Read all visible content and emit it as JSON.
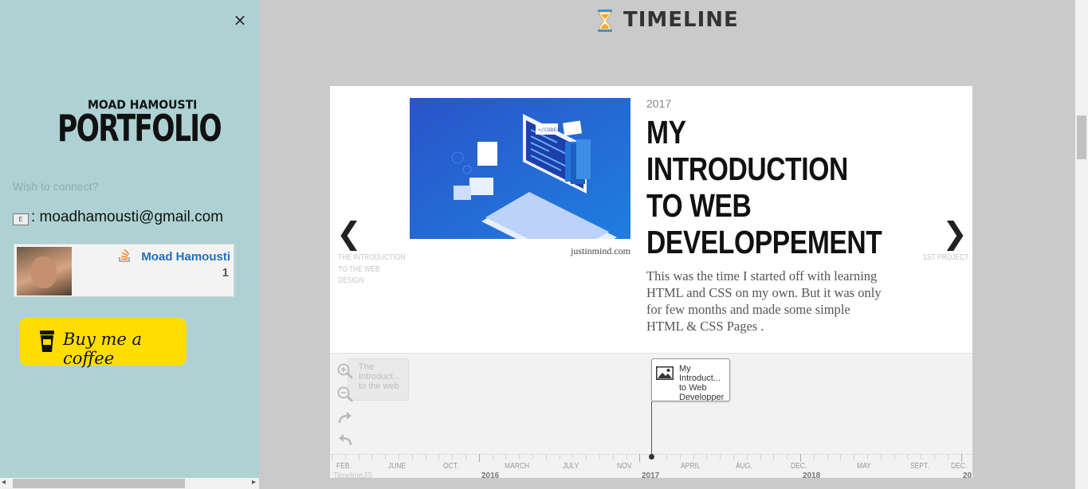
{
  "sidebar": {
    "close_label": "×",
    "logo": {
      "small_text": "MOAD HAMOUSTI",
      "big_text": "PORTFOLIO"
    },
    "connect_label": "Wish to connect?",
    "email": ": moadhamousti@gmail.com",
    "mail_icon_letter": "E",
    "stackoverflow": {
      "name": "Moad Hamousti",
      "reputation": "1",
      "icon": "stackoverflow-icon"
    },
    "coffee": {
      "label": "Buy me a coffee",
      "icon": "coffee-cup-icon",
      "bg": "#ffdd00"
    },
    "bg": "#aed2d3"
  },
  "header": {
    "title": "TIMELINE",
    "icon": "hourglass-icon"
  },
  "timeline": {
    "slide": {
      "year": "2017",
      "headline": "MY INTRODUCTION TO WEB DEVELOPPEMENT",
      "text": "This was the time I started off with learning HTML and CSS on my own. But it was only for few months and made some simple HTML & CSS Pages .",
      "credit": "justinmind.com",
      "image_code_tag": "</CODE>"
    },
    "prev_caption": "THE INTRODUCTION TO THE WEB DESIGN",
    "next_caption": "1ST PROJECT",
    "markers": {
      "prev": "The Introduct... to the web",
      "current": "My Introduct... to Web Developper"
    },
    "axis": {
      "minor": [
        "FEB.",
        "JUNE",
        "OCT.",
        "MARCH",
        "JULY",
        "NOV.",
        "APRIL",
        "AUG.",
        "DEC.",
        "MAY",
        "SEPT.",
        "DEC."
      ],
      "major": [
        "2016",
        "2017",
        "2018",
        "20"
      ]
    },
    "brand": "TimelineJS",
    "tools": [
      "zoom-in-icon",
      "zoom-out-icon",
      "redo-icon",
      "undo-icon"
    ]
  }
}
